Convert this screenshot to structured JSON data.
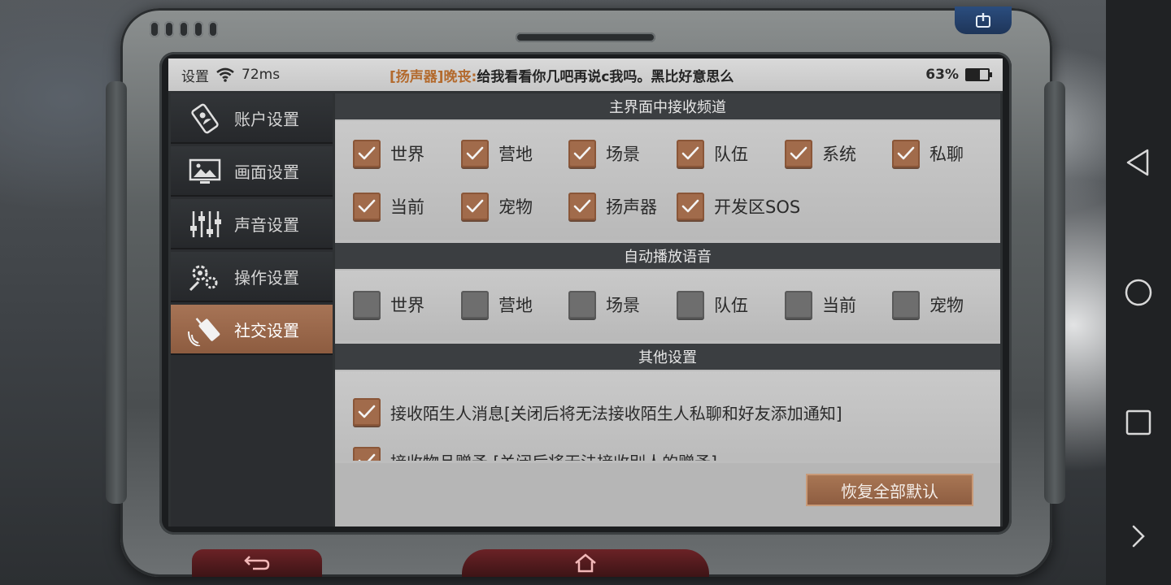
{
  "status_bar": {
    "settings_label": "设置",
    "ping": "72ms",
    "ticker_speaker": "[扬声器]",
    "ticker_sender": "晚丧:",
    "ticker_message": "给我看看你几吧再说c我吗。黑比好意思么",
    "battery": "63%",
    "battery_level": 0.63
  },
  "sidebar": {
    "items": [
      {
        "label": "账户设置",
        "icon": "account-phone-icon"
      },
      {
        "label": "画面设置",
        "icon": "display-icon"
      },
      {
        "label": "声音设置",
        "icon": "sound-sliders-icon"
      },
      {
        "label": "操作设置",
        "icon": "gears-icon"
      },
      {
        "label": "社交设置",
        "icon": "walkie-talkie-icon",
        "active": true
      }
    ]
  },
  "sections": {
    "receive_channels": {
      "title": "主界面中接收频道",
      "items": [
        {
          "label": "世界",
          "checked": true
        },
        {
          "label": "营地",
          "checked": true
        },
        {
          "label": "场景",
          "checked": true
        },
        {
          "label": "队伍",
          "checked": true
        },
        {
          "label": "系统",
          "checked": true
        },
        {
          "label": "私聊",
          "checked": true
        },
        {
          "label": "当前",
          "checked": true
        },
        {
          "label": "宠物",
          "checked": true
        },
        {
          "label": "扬声器",
          "checked": true
        },
        {
          "label": "开发区SOS",
          "checked": true
        }
      ]
    },
    "auto_voice": {
      "title": "自动播放语音",
      "items": [
        {
          "label": "世界",
          "checked": false
        },
        {
          "label": "营地",
          "checked": false
        },
        {
          "label": "场景",
          "checked": false
        },
        {
          "label": "队伍",
          "checked": false
        },
        {
          "label": "当前",
          "checked": false
        },
        {
          "label": "宠物",
          "checked": false
        }
      ]
    },
    "other": {
      "title": "其他设置",
      "items": [
        {
          "label": "接收陌生人消息[关闭后将无法接收陌生人私聊和好友添加通知]",
          "checked": true
        },
        {
          "label": "接收物品赠予 [关闭后将无法接收别人的赠予]",
          "checked": true
        }
      ]
    }
  },
  "footer": {
    "reset_label": "恢复全部默认"
  },
  "colors": {
    "accent": "#a16b4b",
    "checkbox_off": "#6e6e6e",
    "section_header": "#3b3e41"
  }
}
